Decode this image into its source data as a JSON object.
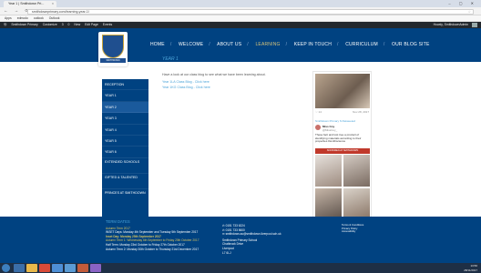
{
  "browser": {
    "tab_title": "Year 1 | Smithdown Pri...",
    "tab_close": "×",
    "url": "smithdownprimary.com/learning-year-1/",
    "bookmarks": [
      "Apps",
      "edmodo",
      "outlook",
      "Outlook"
    ]
  },
  "wpbar": {
    "items": [
      "Smithdown Primary",
      "Customize",
      "3",
      "0",
      "New",
      "Edit Page",
      "Events"
    ],
    "howdy": "Howdy, SmithdownAdmin"
  },
  "header": {
    "crest_motto": "SMITHDOWN",
    "nav": [
      "HOME",
      "WELCOME",
      "ABOUT US",
      "LEARNING",
      "KEEP IN TOUCH",
      "CURRICULUM",
      "OUR BLOG SITE"
    ],
    "active_nav": "LEARNING"
  },
  "page": {
    "title": "YEAR 1",
    "intro": "Have a look at our class blog to see what we have been learning about.",
    "links": [
      "Year 1LA Class Blog - Click here",
      "Year 1KG Class Blog - Click here"
    ]
  },
  "sidebar": {
    "items": [
      "RECEPTION",
      "YEAR 1",
      "YEAR 2",
      "YEAR 3",
      "YEAR 4",
      "YEAR 5",
      "YEAR 6",
      "EXTENDED SCHOOLS",
      "GIFTED & TALENTED",
      "PRINCES AT SMITHDOWN"
    ],
    "active": "YEAR 2"
  },
  "twitter": {
    "counts": "♡ 14",
    "date": "Nov 28, 2017",
    "retweet": "Smithdown Primary S Retweeted",
    "author": "Miss Coy",
    "handle": "@MissCoy_",
    "text": "These fact and lost tree a product of identifying materials according to their properties #smithscience",
    "banner": "SNOWMEN AT SMITHDOWN"
  },
  "footer": {
    "term_heading": "TERM DATES",
    "terms": [
      "Autumn Term 2017",
      "INSET Days: Monday 4th September and Tuesday 5th September 2017",
      "Inset Day: Monday 25th September 2017",
      "Autumn Term 1: Wednesday 6th September to Friday 20th October 2017",
      "Half Term: Monday 23rd October to Friday 27th October 2017",
      "Autumn Term 2: Monday 30th October to Thursday 21st December 2017"
    ],
    "phone1": "0151 733 6224",
    "phone2": "0151 733 5600",
    "email": "smithdown.ao@smithdown.liverpool.sch.uk",
    "address": [
      "Smithdown Primary School",
      "Chatbrook Drive",
      "Liverpool",
      "L7 6LJ"
    ],
    "links": [
      "Terms & Conditions",
      "Privacy Policy",
      "Accessibility"
    ]
  },
  "taskbar": {
    "time": "13:56",
    "date": "28/11/2017"
  }
}
